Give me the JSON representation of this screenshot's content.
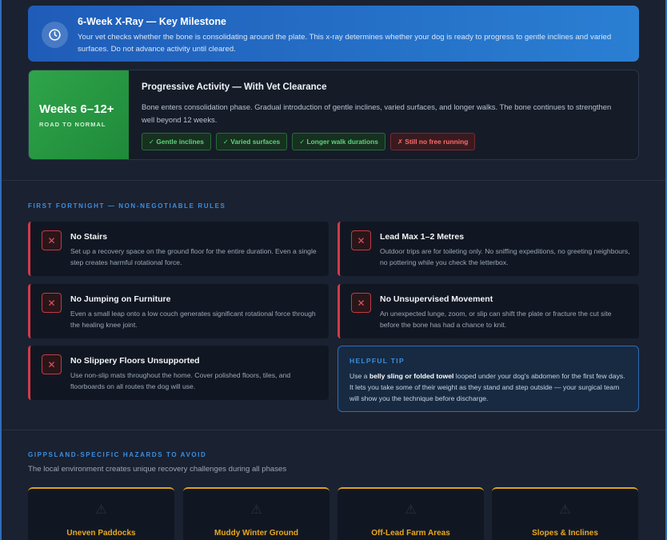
{
  "milestone": {
    "title": "6-Week X-Ray — Key Milestone",
    "body": "Your vet checks whether the bone is consolidating around the plate. This x-ray determines whether your dog is ready to progress to gentle inclines and varied surfaces. Do not advance activity until cleared.",
    "icon": "clock-icon"
  },
  "phase": {
    "weeks": "Weeks 6–12+",
    "subtitle": "ROAD TO NORMAL",
    "title": "Progressive Activity — With Vet Clearance",
    "body": "Bone enters consolidation phase. Gradual introduction of gentle inclines, varied surfaces, and longer walks. The bone continues to strengthen well beyond 12 weeks.",
    "tags": [
      {
        "label": "✓ Gentle inclines",
        "kind": "ok"
      },
      {
        "label": "✓ Varied surfaces",
        "kind": "ok"
      },
      {
        "label": "✓ Longer walk durations",
        "kind": "ok"
      },
      {
        "label": "✗ Still no free running",
        "kind": "no"
      }
    ],
    "accent": "#2fa44a"
  },
  "rules_section": {
    "label": "FIRST FORTNIGHT — NON-NEGOTIABLE RULES",
    "rules": [
      {
        "title": "No Stairs",
        "body": "Set up a recovery space on the ground floor for the entire duration. Even a single step creates harmful rotational force."
      },
      {
        "title": "Lead Max 1–2 Metres",
        "body": "Outdoor trips are for toileting only. No sniffing expeditions, no greeting neighbours, no pottering while you check the letterbox."
      },
      {
        "title": "No Jumping on Furniture",
        "body": "Even a small leap onto a low couch generates significant rotational force through the healing knee joint."
      },
      {
        "title": "No Unsupervised Movement",
        "body": "An unexpected lunge, zoom, or slip can shift the plate or fracture the cut site before the bone has had a chance to knit."
      },
      {
        "title": "No Slippery Floors Unsupported",
        "body": "Use non-slip mats throughout the home. Cover polished floors, tiles, and floorboards on all routes the dog will use."
      }
    ],
    "x_glyph": "✕",
    "danger_color": "#d23a48"
  },
  "tip": {
    "label": "HELPFUL TIP",
    "pre": "Use a ",
    "bold": "belly sling or folded towel",
    "post": " looped under your dog's abdomen for the first few days. It lets you take some of their weight as they stand and step outside — your surgical team will show you the technique before discharge."
  },
  "gippsland": {
    "label": "GIPPSLAND-SPECIFIC HAZARDS TO AVOID",
    "subtitle": "The local environment creates unique recovery challenges during all phases",
    "hazards": [
      {
        "title": "Uneven Paddocks",
        "icon": "warning-icon"
      },
      {
        "title": "Muddy Winter Ground",
        "icon": "warning-icon"
      },
      {
        "title": "Off-Lead Farm Areas",
        "icon": "warning-icon"
      },
      {
        "title": "Slopes & Inclines",
        "icon": "warning-icon"
      }
    ],
    "warning_glyph": "⚠",
    "accent": "#e0a11b"
  }
}
